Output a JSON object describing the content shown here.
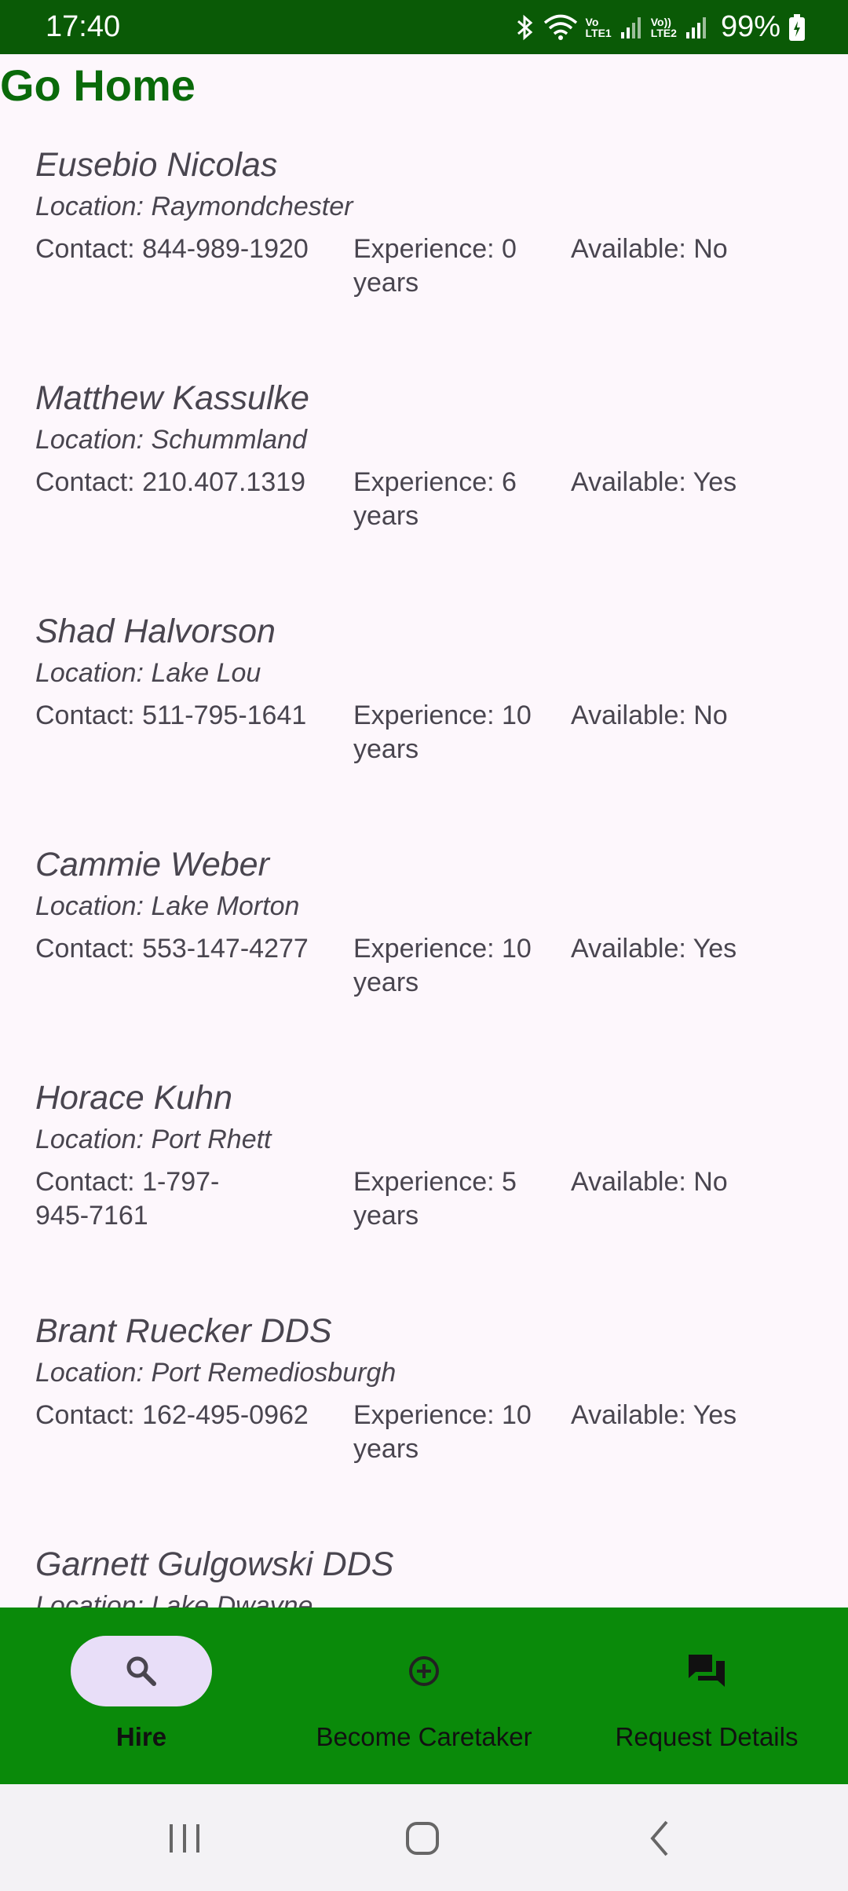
{
  "status_bar": {
    "time": "17:40",
    "net1_top": "Vo",
    "net1_bottom": "LTE1",
    "net2_top": "Vo))",
    "net2_bottom": "LTE2",
    "battery": "99%"
  },
  "header": {
    "title": "Go Home"
  },
  "caretakers": [
    {
      "name": "Eusebio Nicolas",
      "location": "Location: Raymondchester",
      "contact": "Contact: 844-989-1920",
      "experience": "Experience: 0 years",
      "available": "Available: No"
    },
    {
      "name": "Matthew Kassulke",
      "location": "Location: Schummland",
      "contact": "Contact: 210.407.1319",
      "experience": "Experience: 6 years",
      "available": "Available: Yes"
    },
    {
      "name": "Shad Halvorson",
      "location": "Location: Lake Lou",
      "contact": "Contact: 511-795-1641",
      "experience": "Experience: 10 years",
      "available": "Available: No"
    },
    {
      "name": "Cammie Weber",
      "location": "Location: Lake Morton",
      "contact": "Contact: 553-147-4277",
      "experience": "Experience: 10 years",
      "available": "Available: Yes"
    },
    {
      "name": "Horace Kuhn",
      "location": "Location: Port Rhett",
      "contact": "Contact: 1-797-945-7161",
      "experience": "Experience: 5 years",
      "available": "Available: No"
    },
    {
      "name": "Brant Ruecker DDS",
      "location": "Location: Port Remediosburgh",
      "contact": "Contact: 162-495-0962",
      "experience": "Experience: 10 years",
      "available": "Available: Yes"
    },
    {
      "name": "Garnett Gulgowski DDS",
      "location": "Location: Lake Dwayne",
      "contact": "",
      "experience": "",
      "available": ""
    }
  ],
  "bottom_nav": {
    "items": [
      {
        "label": "Hire",
        "icon": "search-icon",
        "active": true
      },
      {
        "label": "Become Caretaker",
        "icon": "add-circle-icon",
        "active": false
      },
      {
        "label": "Request Details",
        "icon": "forum-icon",
        "active": false
      }
    ]
  },
  "colors": {
    "status_bar": "#0a5a06",
    "title": "#0a6a0a",
    "bottom_nav": "#0a8a0a",
    "active_pill": "#e8def8",
    "background": "#fdf7fc"
  }
}
